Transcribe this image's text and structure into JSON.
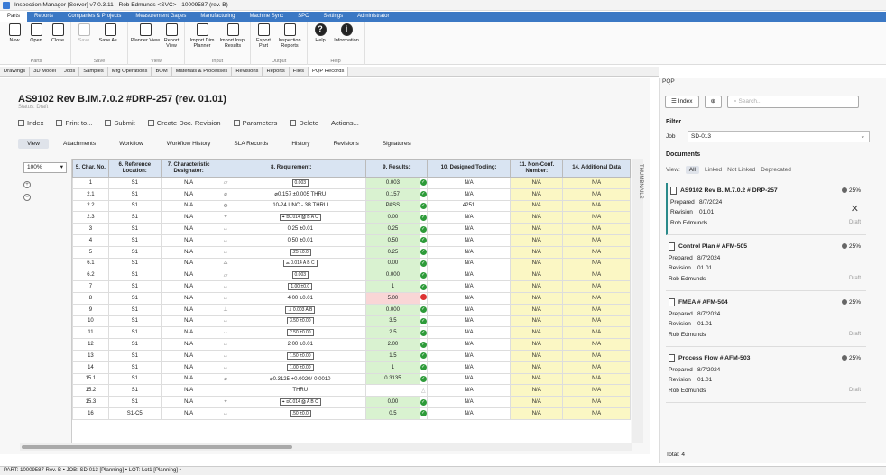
{
  "window_title": "Inspection Manager [Server] v7.0.3.11 - Rob Edmunds <SVC> - 10009587 (rev. B)",
  "menu_tabs": [
    "Parts",
    "Reports",
    "Companies & Projects",
    "Measurement Gages",
    "Manufacturing",
    "Machine Sync",
    "SPC",
    "Settings",
    "Administrator"
  ],
  "ribbon": {
    "new": "New",
    "open": "Open",
    "close": "Close",
    "parts_group": "Parts",
    "save": "Save",
    "save_as": "Save As...",
    "save_group": "Save",
    "planner_view": "Planner View",
    "report_view": "Report View",
    "view_group": "View",
    "import_dim": "Import Dim Planner",
    "import_insp": "Import Insp. Results",
    "input_group": "Input",
    "export_part": "Export Part",
    "inspection_reports": "Inspection Reports",
    "output_group": "Output",
    "help": "Help",
    "information": "Information",
    "help_group": "Help"
  },
  "sub_tabs": [
    "Drawings",
    "3D Model",
    "Jobs",
    "Samples",
    "Mfg Operations",
    "BOM",
    "Materials & Processes",
    "Revisions",
    "Reports",
    "Files",
    "PQP Records"
  ],
  "document": {
    "title": "AS9102 Rev B.IM.7.0.2 #DRP-257 (rev. 01.01)",
    "status": "Status: Draft",
    "toolbar": [
      "Index",
      "Print to...",
      "Submit",
      "Create Doc. Revision",
      "Parameters",
      "Delete",
      "Actions..."
    ],
    "view_tabs": [
      "View",
      "Attachments",
      "Workflow",
      "Workflow History",
      "SLA Records",
      "History",
      "Revisions",
      "Signatures"
    ],
    "zoom": "100%",
    "headers": [
      "5. Char. No.",
      "6. Reference Location:",
      "7. Characteristic Designator:",
      "8. Requirement:",
      "9. Results:",
      "10. Designed Tooling:",
      "11. Non-Conf. Number:",
      "14. Additional Data"
    ],
    "rows": [
      {
        "no": "1",
        "ref": "S1",
        "des": "N/A",
        "sym": "▱",
        "req": "0.003",
        "boxed": true,
        "res": "0.003",
        "st": "ok",
        "tool": "N/A",
        "nc": "N/A",
        "add": "N/A"
      },
      {
        "no": "2.1",
        "ref": "S1",
        "des": "N/A",
        "sym": "⌀",
        "req": "⌀0.157 ±0.005 THRU",
        "boxed": false,
        "res": "0.157",
        "st": "ok",
        "tool": "N/A",
        "nc": "N/A",
        "add": "N/A"
      },
      {
        "no": "2.2",
        "ref": "S1",
        "des": "N/A",
        "sym": "⚙",
        "req": "10-24 UNC - 3B THRU",
        "boxed": false,
        "res": "PASS",
        "st": "ok",
        "tool": "4251",
        "nc": "N/A",
        "add": "N/A"
      },
      {
        "no": "2.3",
        "ref": "S1",
        "des": "N/A",
        "sym": "⌖",
        "req": "⌖ ⌀0.014 Ⓜ B A C",
        "boxed": true,
        "res": "0.00",
        "st": "ok",
        "tool": "N/A",
        "nc": "N/A",
        "add": "N/A"
      },
      {
        "no": "3",
        "ref": "S1",
        "des": "N/A",
        "sym": "↔",
        "req": "0.25 ±0.01",
        "boxed": false,
        "res": "0.25",
        "st": "ok",
        "tool": "N/A",
        "nc": "N/A",
        "add": "N/A"
      },
      {
        "no": "4",
        "ref": "S1",
        "des": "N/A",
        "sym": "↔",
        "req": "0.50 ±0.01",
        "boxed": false,
        "res": "0.50",
        "st": "ok",
        "tool": "N/A",
        "nc": "N/A",
        "add": "N/A"
      },
      {
        "no": "5",
        "ref": "S1",
        "des": "N/A",
        "sym": "↔",
        "req": ".25 ±0.0",
        "boxed": true,
        "res": "0.25",
        "st": "ok",
        "tool": "N/A",
        "nc": "N/A",
        "add": "N/A"
      },
      {
        "no": "6.1",
        "ref": "S1",
        "des": "N/A",
        "sym": "⌓",
        "req": "⌓ 0.014 A B C",
        "boxed": true,
        "res": "0.00",
        "st": "ok",
        "tool": "N/A",
        "nc": "N/A",
        "add": "N/A"
      },
      {
        "no": "6.2",
        "ref": "S1",
        "des": "N/A",
        "sym": "▱",
        "req": "0.003",
        "boxed": true,
        "res": "0.000",
        "st": "ok",
        "tool": "N/A",
        "nc": "N/A",
        "add": "N/A"
      },
      {
        "no": "7",
        "ref": "S1",
        "des": "N/A",
        "sym": "↔",
        "req": "1.00 ±0.0",
        "boxed": true,
        "res": "1",
        "st": "ok",
        "tool": "N/A",
        "nc": "N/A",
        "add": "N/A"
      },
      {
        "no": "8",
        "ref": "S1",
        "des": "N/A",
        "sym": "↔",
        "req": "4.00 ±0.01",
        "boxed": false,
        "res": "5.00",
        "st": "bad",
        "tool": "N/A",
        "nc": "N/A",
        "add": "N/A"
      },
      {
        "no": "9",
        "ref": "S1",
        "des": "N/A",
        "sym": "⊥",
        "req": "⊥ 0.003 A B",
        "boxed": true,
        "res": "0.000",
        "st": "ok",
        "tool": "N/A",
        "nc": "N/A",
        "add": "N/A"
      },
      {
        "no": "10",
        "ref": "S1",
        "des": "N/A",
        "sym": "↔",
        "req": "3.50 ±0.00",
        "boxed": true,
        "res": "3.5",
        "st": "ok",
        "tool": "N/A",
        "nc": "N/A",
        "add": "N/A"
      },
      {
        "no": "11",
        "ref": "S1",
        "des": "N/A",
        "sym": "↔",
        "req": "2.50 ±0.00",
        "boxed": true,
        "res": "2.5",
        "st": "ok",
        "tool": "N/A",
        "nc": "N/A",
        "add": "N/A"
      },
      {
        "no": "12",
        "ref": "S1",
        "des": "N/A",
        "sym": "↔",
        "req": "2.00 ±0.01",
        "boxed": false,
        "res": "2.00",
        "st": "ok",
        "tool": "N/A",
        "nc": "N/A",
        "add": "N/A"
      },
      {
        "no": "13",
        "ref": "S1",
        "des": "N/A",
        "sym": "↔",
        "req": "1.50 ±0.00",
        "boxed": true,
        "res": "1.5",
        "st": "ok",
        "tool": "N/A",
        "nc": "N/A",
        "add": "N/A"
      },
      {
        "no": "14",
        "ref": "S1",
        "des": "N/A",
        "sym": "↔",
        "req": "1.00 ±0.00",
        "boxed": true,
        "res": "1",
        "st": "ok",
        "tool": "N/A",
        "nc": "N/A",
        "add": "N/A"
      },
      {
        "no": "15.1",
        "ref": "S1",
        "des": "N/A",
        "sym": "⌀",
        "req": "⌀0.3125 +0.0020/-0.0010",
        "boxed": false,
        "res": "0.3135",
        "st": "ok",
        "tool": "N/A",
        "nc": "N/A",
        "add": "N/A"
      },
      {
        "no": "15.2",
        "ref": "S1",
        "des": "N/A",
        "sym": "",
        "req": "THRU",
        "boxed": false,
        "res": "",
        "st": "na",
        "tool": "N/A",
        "nc": "N/A",
        "add": "N/A"
      },
      {
        "no": "15.3",
        "ref": "S1",
        "des": "N/A",
        "sym": "⌖",
        "req": "⌖ ⌀0.014 Ⓜ A B C",
        "boxed": true,
        "res": "0.00",
        "st": "ok",
        "tool": "N/A",
        "nc": "N/A",
        "add": "N/A"
      },
      {
        "no": "16",
        "ref": "S1-C5",
        "des": "N/A",
        "sym": "↔",
        "req": ".50 ±0.0",
        "boxed": true,
        "res": "0.5",
        "st": "ok",
        "tool": "N/A",
        "nc": "N/A",
        "add": "N/A"
      }
    ],
    "thumbnails": "THUMBNAILS"
  },
  "pqp": {
    "panel_title": "PQP",
    "index_btn": "Index",
    "search_placeholder": "Search...",
    "filter_label": "Filter",
    "job_label": "Job",
    "job_value": "SD-013",
    "documents_label": "Documents",
    "view_label": "View:",
    "filters": [
      "All",
      "Linked",
      "Not Linked",
      "Deprecated"
    ],
    "prepared_label": "Prepared",
    "revision_label": "Revision",
    "docs": [
      {
        "title": "AS9102 Rev B.IM.7.0.2 # DRP-257",
        "pct": "25%",
        "prepared": "8/7/2024",
        "revision": "01.01",
        "author": "Rob Edmunds",
        "status": "Draft"
      },
      {
        "title": "Control Plan # AFM-505",
        "pct": "25%",
        "prepared": "8/7/2024",
        "revision": "01.01",
        "author": "Rob Edmunds",
        "status": "Draft"
      },
      {
        "title": "FMEA # AFM-504",
        "pct": "25%",
        "prepared": "8/7/2024",
        "revision": "01.01",
        "author": "Rob Edmunds",
        "status": "Draft"
      },
      {
        "title": "Process Flow # AFM-503",
        "pct": "25%",
        "prepared": "8/7/2024",
        "revision": "01.01",
        "author": "Rob Edmunds",
        "status": "Draft"
      }
    ],
    "total": "Total: 4"
  },
  "statusbar": "PART: 10009587 Rev. B  •  JOB: SD-013 [Planning]  •  LOT: Lot1 [Planning]  •"
}
